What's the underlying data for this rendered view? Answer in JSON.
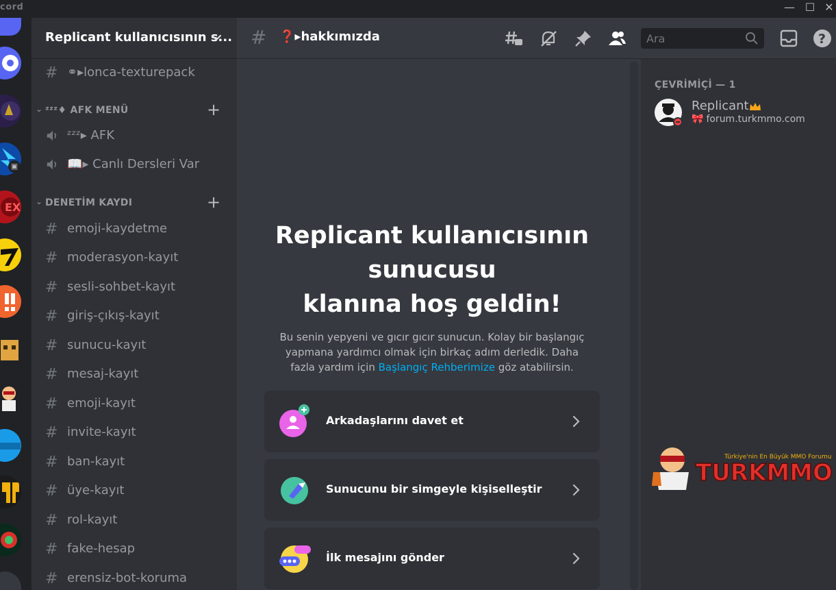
{
  "window": {
    "brand": "cord",
    "minimize": "—",
    "maximize": "☐",
    "close": "✕"
  },
  "guild": {
    "name": "Replicant kullanıcısının s..."
  },
  "sidebar": {
    "channels_top": [
      {
        "name": "⚭▸lonca-texturepack"
      }
    ],
    "categories": [
      {
        "label": "ᶻᶻᶻ♦ AFK MENÜ",
        "voice": [
          {
            "name": "ᶻᶻᶻ▸ AFK"
          },
          {
            "name": "📖▸ Canlı Dersleri Var"
          }
        ]
      },
      {
        "label": "DENETİM KAYDI",
        "channels": [
          "emoji-kaydetme",
          "moderasyon-kayıt",
          "sesli-sohbet-kayıt",
          "giriş-çıkış-kayıt",
          "sunucu-kayıt",
          "mesaj-kayıt",
          "emoji-kayıt",
          "invite-kayıt",
          "ban-kayıt",
          "üye-kayıt",
          "rol-kayıt",
          "fake-hesap",
          "erensiz-bot-koruma"
        ]
      }
    ]
  },
  "topbar": {
    "channel_name": "❓▸hakkımızda",
    "search_placeholder": "Ara",
    "icons": [
      "threads-icon",
      "mute-bell-icon",
      "pin-icon",
      "members-icon",
      "inbox-icon",
      "help-icon"
    ]
  },
  "welcome": {
    "title_line1": "Replicant kullanıcısının",
    "title_line2": "sunucusu",
    "title_line3": "klanına hoş geldin!",
    "sub_before": "Bu senin yepyeni ve gıcır gıcır sunucun. Kolay bir başlangıç yapmana yardımcı olmak için birkaç adım derledik. Daha fazla yardım için ",
    "sub_link": "Başlangıç Rehberimize",
    "sub_after": " göz atabilirsin.",
    "cards": [
      {
        "label": "Arkadaşlarını davet et",
        "icon": "invite-icon"
      },
      {
        "label": "Sunucunu bir simgeyle kişiselleştir",
        "icon": "brush-icon"
      },
      {
        "label": "İlk mesajını gönder",
        "icon": "message-icon"
      }
    ]
  },
  "members": {
    "header": "ÇEVRİMİÇİ — 1",
    "list": [
      {
        "name": "Replicant",
        "status": "forum.turkmmo.com"
      }
    ],
    "banner_text": "TURKMMO",
    "banner_tagline": "Türkiye'nin En Büyük MMO Forumu"
  },
  "colors": {
    "accent": "#5865f2",
    "link": "#00aff4",
    "invite_icon": "#e964e8",
    "brush_icon": "#47c2a1",
    "message_icon": "#f7d548",
    "dnd": "#ed4245",
    "crown": "#faa61a"
  }
}
